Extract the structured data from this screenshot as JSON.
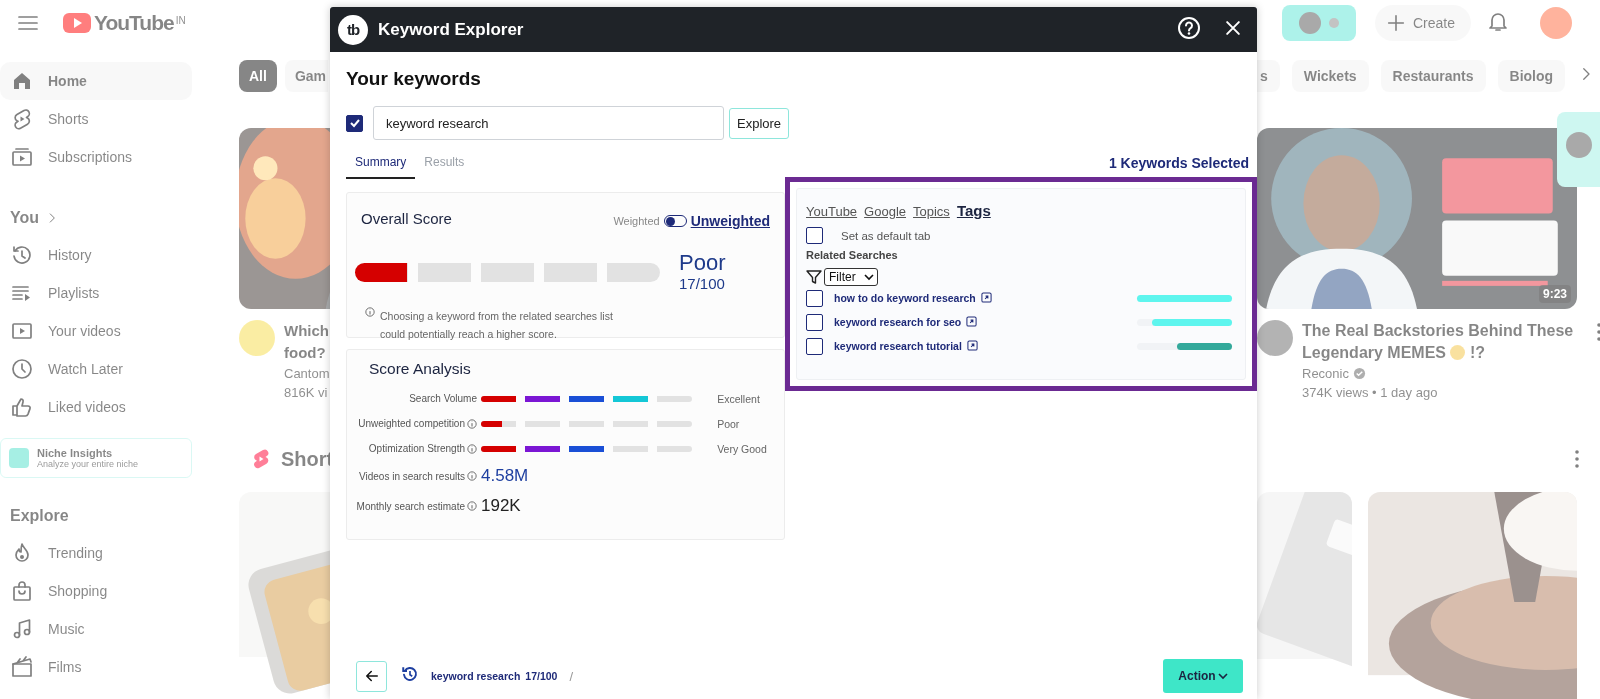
{
  "youtube": {
    "logo_text": "YouTube",
    "region": "IN",
    "sidebar": {
      "main": [
        {
          "label": "Home",
          "selected": true
        },
        {
          "label": "Shorts",
          "selected": false
        },
        {
          "label": "Subscriptions",
          "selected": false
        }
      ],
      "you_heading": "You",
      "you": [
        {
          "label": "History",
          "selected": false
        },
        {
          "label": "Playlists",
          "selected": false
        },
        {
          "label": "Your videos",
          "selected": false
        },
        {
          "label": "Watch Later",
          "selected": false
        },
        {
          "label": "Liked videos",
          "selected": false
        }
      ],
      "niche_card": {
        "title": "Niche Insights",
        "subtitle": "Analyze your entire niche"
      },
      "explore_heading": "Explore",
      "explore": [
        {
          "label": "Trending",
          "selected": false
        },
        {
          "label": "Shopping",
          "selected": false
        },
        {
          "label": "Music",
          "selected": false
        },
        {
          "label": "Films",
          "selected": false
        }
      ]
    },
    "create_button": "Create",
    "chips_left": [
      {
        "label": "All",
        "selected": true
      },
      {
        "label": "Gam",
        "selected": false
      }
    ],
    "chips_right": [
      {
        "label": "s",
        "selected": false
      },
      {
        "label": "Wickets",
        "selected": false
      },
      {
        "label": "Restaurants",
        "selected": false
      },
      {
        "label": "Biolog",
        "selected": false
      }
    ],
    "video_left": {
      "title_lines": [
        "Which",
        "food?"
      ],
      "channel": "Cantom",
      "meta": "816K vi"
    },
    "video_right": {
      "duration": "9:23",
      "title": "The Real Backstories Behind These Legendary MEMES",
      "title_end": "!?",
      "channel": "Reconic",
      "meta": "374K views • 1 day ago"
    },
    "shorts_heading": "Short"
  },
  "keyword_explorer": {
    "logo": "tb",
    "title": "Keyword Explorer",
    "heading": "Your keywords",
    "keyword": {
      "checked": true,
      "value": "keyword research"
    },
    "explore_button": "Explore",
    "tabs": [
      {
        "label": "Summary",
        "selected": true
      },
      {
        "label": "Results",
        "selected": false
      }
    ],
    "selected_count": "1 Keywords Selected",
    "overall": {
      "title": "Overall Score",
      "toggle": {
        "left": "Weighted",
        "right": "Unweighted",
        "on": false
      },
      "level": 0.17,
      "rating": "Poor",
      "score": "17/100",
      "note": "Choosing a keyword from the related searches list could potentially reach a higher score."
    },
    "analysis": {
      "title": "Score Analysis",
      "meters": [
        {
          "label": "Search Volume",
          "info": false,
          "level": 0.82,
          "rating": "Excellent"
        },
        {
          "label": "Unweighted competition",
          "info": true,
          "level": 0.1,
          "rating": "Poor"
        },
        {
          "label": "Optimization Strength",
          "info": true,
          "level": 0.61,
          "rating": "Very Good"
        }
      ],
      "stats": [
        {
          "label": "Videos in search results",
          "value": "4.58M",
          "highlight": true
        },
        {
          "label": "Monthly search estimate",
          "value": "192K",
          "highlight": false
        }
      ]
    },
    "related": {
      "tabs": [
        {
          "label": "YouTube",
          "selected": false
        },
        {
          "label": "Google",
          "selected": false
        },
        {
          "label": "Topics",
          "selected": false
        },
        {
          "label": "Tags",
          "selected": true
        }
      ],
      "default_tab": {
        "label": "Set as default tab",
        "checked": false
      },
      "heading": "Related Searches",
      "filter": "Filter",
      "items": [
        {
          "text": "how to do keyword research",
          "checked": false,
          "level": 1.0,
          "color": "#5ef5ee"
        },
        {
          "text": "keyword research for seo",
          "checked": false,
          "level": 0.84,
          "color": "#5ef5ee"
        },
        {
          "text": "keyword research tutorial",
          "checked": false,
          "level": 0.58,
          "color": "#33a99b"
        }
      ]
    },
    "footer": {
      "keyword": "keyword research",
      "score": "17/100",
      "separator": "/",
      "action": "Action"
    }
  }
}
